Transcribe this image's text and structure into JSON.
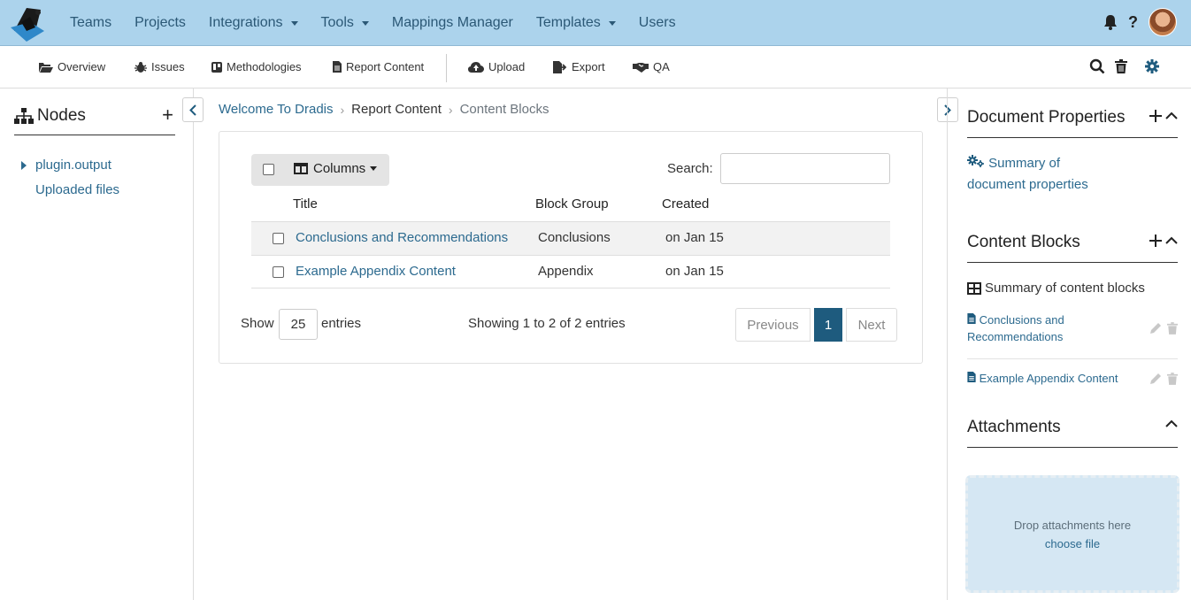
{
  "nav": {
    "items": [
      {
        "label": "Teams",
        "dropdown": false
      },
      {
        "label": "Projects",
        "dropdown": false
      },
      {
        "label": "Integrations",
        "dropdown": true
      },
      {
        "label": "Tools",
        "dropdown": true
      },
      {
        "label": "Mappings Manager",
        "dropdown": false
      },
      {
        "label": "Templates",
        "dropdown": true
      },
      {
        "label": "Users",
        "dropdown": false
      }
    ],
    "help": "?"
  },
  "subnav": {
    "overview": "Overview",
    "issues": "Issues",
    "methodologies": "Methodologies",
    "report_content": "Report Content",
    "upload": "Upload",
    "export": "Export",
    "qa": "QA"
  },
  "sidebar": {
    "title": "Nodes",
    "add": "+",
    "nodes": [
      "plugin.output",
      "Uploaded files"
    ]
  },
  "breadcrumb": [
    "Welcome To Dradis",
    "Report Content",
    "Content Blocks"
  ],
  "table": {
    "columns_label": "Columns",
    "search_label": "Search:",
    "search_value": "",
    "headers": [
      "Title",
      "Block Group",
      "Created"
    ],
    "rows": [
      {
        "title": "Conclusions and Recommendations",
        "group": "Conclusions",
        "created": "on Jan 15"
      },
      {
        "title": "Example Appendix Content",
        "group": "Appendix",
        "created": "on Jan 15"
      }
    ],
    "show_label": "Show",
    "page_length": "25",
    "entries_label": "entries",
    "info": "Showing 1 to 2 of 2 entries",
    "prev": "Previous",
    "current_page": "1",
    "next": "Next"
  },
  "right": {
    "doc_props_title": "Document Properties",
    "doc_props_link": "Summary of document properties",
    "content_blocks_title": "Content Blocks",
    "content_blocks_summary": "Summary of content blocks",
    "blocks": [
      "Conclusions and Recommendations",
      "Example Appendix Content"
    ],
    "attachments_title": "Attachments",
    "drop_text": "Drop attachments here",
    "choose_file": "choose file"
  },
  "colors": {
    "topbar": "#acd3ec",
    "link": "#2c6a8f",
    "active_page": "#1e5b7e",
    "dropzone": "#d5e7f3"
  }
}
